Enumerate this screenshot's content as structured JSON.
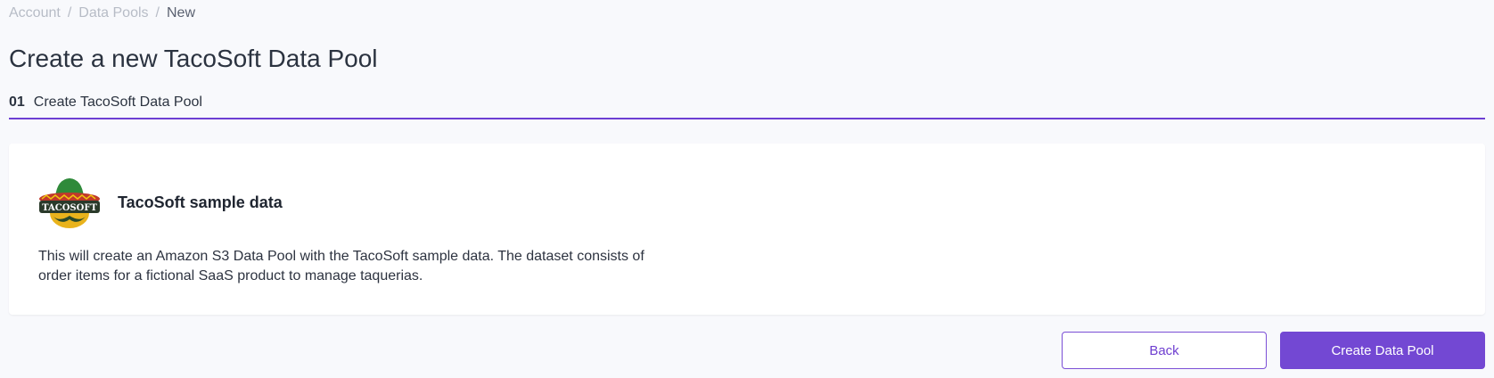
{
  "breadcrumb": {
    "items": [
      "Account",
      "Data Pools"
    ],
    "current": "New",
    "separator": "/"
  },
  "page": {
    "title": "Create a new TacoSoft Data Pool"
  },
  "steps": [
    {
      "number": "01",
      "label": "Create TacoSoft Data Pool"
    }
  ],
  "card": {
    "logo_text": "TACOSOFT",
    "logo_icon": "tacosoft-logo-icon",
    "title": "TacoSoft sample data",
    "description": "This will create an Amazon S3 Data Pool with the TacoSoft sample data. The dataset consists of order items for a fictional SaaS product to manage taquerias."
  },
  "actions": {
    "back_label": "Back",
    "create_label": "Create Data Pool"
  },
  "colors": {
    "accent": "#7348d3",
    "background": "#f8f9fc",
    "card": "#ffffff"
  }
}
